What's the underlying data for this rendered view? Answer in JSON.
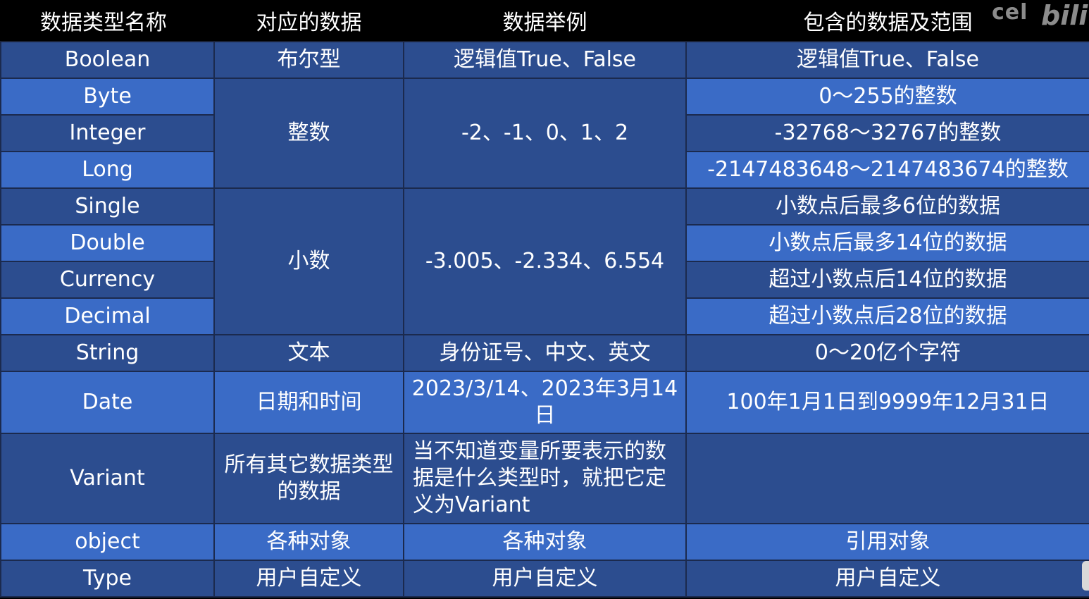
{
  "table": {
    "headers": [
      "数据类型名称",
      "对应的数据",
      "数据举例",
      "包含的数据及范围"
    ],
    "rows": [
      {
        "name": "Boolean",
        "category": "布尔型",
        "example": "逻辑值True、False",
        "range": "逻辑值True、False"
      },
      {
        "name": "Byte",
        "category": "整数",
        "example": "-2、-1、0、1、2",
        "range": "0～255的整数"
      },
      {
        "name": "Integer",
        "range": "-32768～32767的整数"
      },
      {
        "name": "Long",
        "range": "-2147483648～2147483674的整数"
      },
      {
        "name": "Single",
        "category": "小数",
        "example": "-3.005、-2.334、6.554",
        "range": "小数点后最多6位的数据"
      },
      {
        "name": "Double",
        "range": "小数点后最多14位的数据"
      },
      {
        "name": "Currency",
        "range": "超过小数点后14位的数据"
      },
      {
        "name": "Decimal",
        "range": "超过小数点后28位的数据"
      },
      {
        "name": "String",
        "category": "文本",
        "example": "身份证号、中文、英文",
        "range": "0～20亿个字符"
      },
      {
        "name": "Date",
        "category": "日期和时间",
        "example": "2023/3/14、2023年3月14日",
        "range": "100年1月1日到9999年12月31日"
      },
      {
        "name": "Variant",
        "category": "所有其它数据类型的数据",
        "example": "当不知道变量所要表示的数据是什么类型时，就把它定义为Variant",
        "range": ""
      },
      {
        "name": "object",
        "category": "各种对象",
        "example": "各种对象",
        "range": "引用对象"
      },
      {
        "name": "Type",
        "category": "用户自定义",
        "example": "用户自定义",
        "range": "用户自定义"
      }
    ]
  },
  "watermark": {
    "text": "cel",
    "logo": "bili"
  },
  "colors": {
    "header_bg": "#000000",
    "row_dark": "#2c4d8f",
    "row_light": "#3a6bc6",
    "border": "#1b2a4e"
  }
}
